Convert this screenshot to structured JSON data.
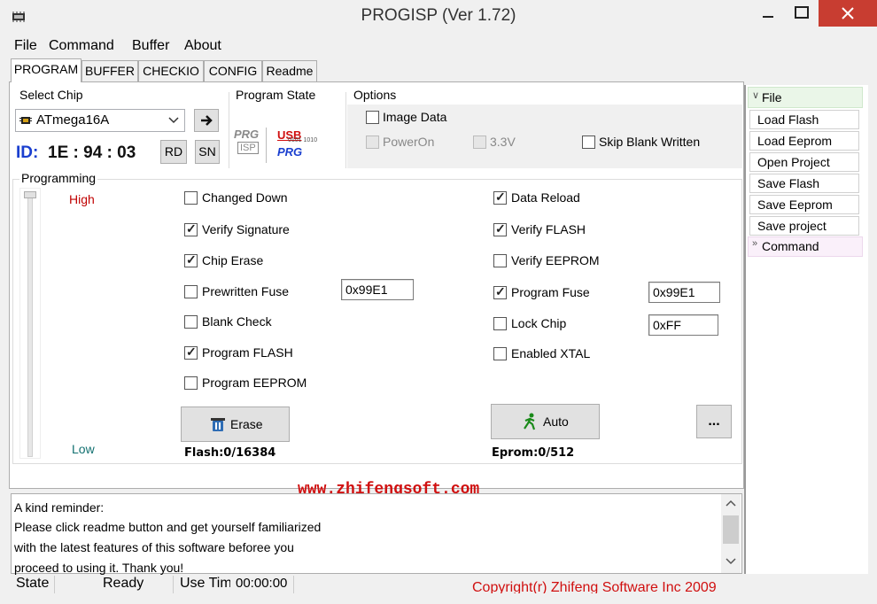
{
  "window": {
    "title": "PROGISP (Ver 1.72)",
    "controls": {
      "minimize": "–",
      "maximize": "☐",
      "close": "✕"
    }
  },
  "menu": [
    "File",
    "Command",
    "Buffer",
    "About"
  ],
  "tabs": [
    "PROGRAM",
    "BUFFER",
    "CHECKIO",
    "CONFIG",
    "Readme"
  ],
  "select_chip": {
    "label": "Select Chip",
    "value": "ATmega16A",
    "id_label": "ID:",
    "id_value": "1E : 94 : 03",
    "rd": "RD",
    "sn": "SN"
  },
  "program_state": {
    "label": "Program State",
    "prg": "PRG",
    "isp": "ISP",
    "usb": "USB",
    "usb_prg": "PRG",
    "usb_bits": "0101 1010"
  },
  "options": {
    "label": "Options",
    "image_data": {
      "label": "Image Data",
      "checked": false
    },
    "power_on": {
      "label": "PowerOn",
      "checked": false,
      "disabled": true
    },
    "v33": {
      "label": "3.3V",
      "checked": false,
      "disabled": true
    },
    "skip_blank": {
      "label": "Skip Blank Written",
      "checked": false
    }
  },
  "programming": {
    "label": "Programming",
    "high": "High",
    "low": "Low",
    "left_options": [
      {
        "label": "Changed Down",
        "checked": false
      },
      {
        "label": "Verify Signature",
        "checked": true
      },
      {
        "label": "Chip Erase",
        "checked": true
      },
      {
        "label": "Prewritten Fuse",
        "checked": false
      },
      {
        "label": "Blank Check",
        "checked": false
      },
      {
        "label": "Program FLASH",
        "checked": true
      },
      {
        "label": "Program EEPROM",
        "checked": false
      }
    ],
    "right_options": [
      {
        "label": "Data Reload",
        "checked": true
      },
      {
        "label": "Verify FLASH",
        "checked": true
      },
      {
        "label": "Verify EEPROM",
        "checked": false
      },
      {
        "label": "Program Fuse",
        "checked": true
      },
      {
        "label": "Lock Chip",
        "checked": false
      },
      {
        "label": "Enabled XTAL",
        "checked": false
      }
    ],
    "prewritten_fuse_value": "0x99E1",
    "program_fuse_value": "0x99E1",
    "lock_chip_value": "0xFF",
    "erase": "Erase",
    "auto": "Auto",
    "more": "...",
    "flash_info": "Flash:0/16384",
    "eprom_info": "Eprom:0/512",
    "website": "www.zhifengsoft.com"
  },
  "sidebar": {
    "file_header": "File",
    "buttons": [
      "Load Flash",
      "Load Eeprom",
      "Open Project",
      "Save Flash",
      "Save Eeprom",
      "Save project"
    ],
    "command_header": "Command"
  },
  "log": [
    "A kind reminder:",
    "Please click readme button and get yourself familiarized",
    "with the latest features of this software beforee you",
    "proceed to using it. Thank you!"
  ],
  "status": {
    "state": "State",
    "ready": "Ready",
    "use_time_label": "Use Time",
    "use_time": "00:00:00",
    "copyright": "Copyright(r) Zhifeng Software Inc 2009"
  },
  "colors": {
    "id_blue": "#1a3fcf",
    "high_red": "#c00000",
    "low_teal": "#127070",
    "website_red": "#d01010",
    "close_red": "#c83d31"
  }
}
